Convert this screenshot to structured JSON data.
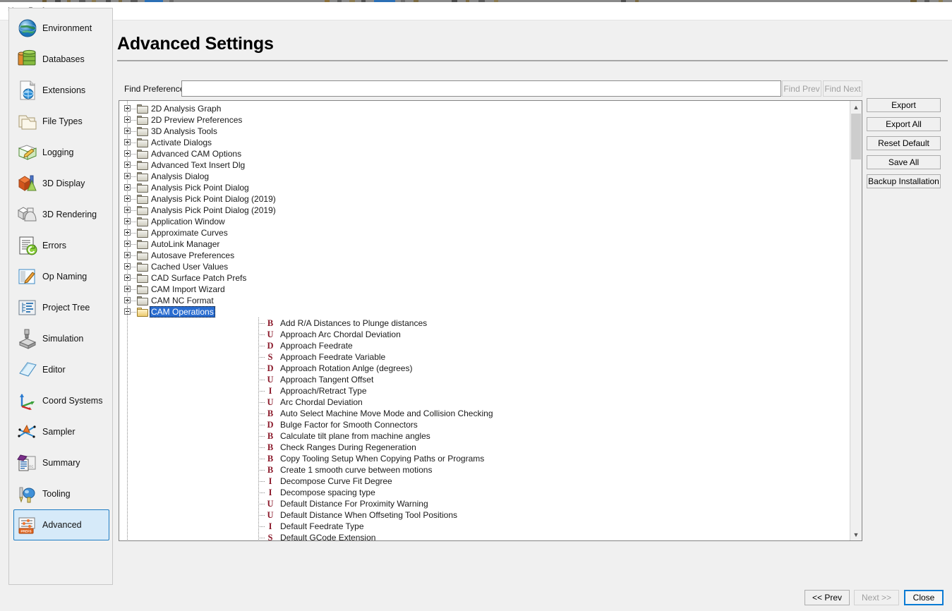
{
  "window": {
    "title": "User Preferences"
  },
  "page": {
    "title": "Advanced Settings"
  },
  "search": {
    "label": "Find Preference",
    "value": "",
    "placeholder": "",
    "find_prev": "Find Prev",
    "find_next": "Find Next"
  },
  "sidebar": {
    "items": [
      {
        "label": "Environment",
        "icon": "globe-icon",
        "selected": false
      },
      {
        "label": "Databases",
        "icon": "database-icon",
        "selected": false
      },
      {
        "label": "Extensions",
        "icon": "file-globe-icon",
        "selected": false
      },
      {
        "label": "File Types",
        "icon": "folders-icon",
        "selected": false
      },
      {
        "label": "Logging",
        "icon": "notebook-pen-icon",
        "selected": false
      },
      {
        "label": "3D Display",
        "icon": "cube-cone-icon",
        "selected": false
      },
      {
        "label": "3D Rendering",
        "icon": "shapes-gray-icon",
        "selected": false
      },
      {
        "label": "Errors",
        "icon": "error-refresh-icon",
        "selected": false
      },
      {
        "label": "Op Naming",
        "icon": "pencil-doc-icon",
        "selected": false
      },
      {
        "label": "Project Tree",
        "icon": "tree-list-icon",
        "selected": false
      },
      {
        "label": "Simulation",
        "icon": "machine-icon",
        "selected": false
      },
      {
        "label": "Editor",
        "icon": "editor-page-icon",
        "selected": false
      },
      {
        "label": "Coord Systems",
        "icon": "axes-icon",
        "selected": false
      },
      {
        "label": "Sampler",
        "icon": "sampler-icon",
        "selected": false
      },
      {
        "label": "Summary",
        "icon": "summary-nc-icon",
        "selected": false
      },
      {
        "label": "Tooling",
        "icon": "tool-icon",
        "selected": false
      },
      {
        "label": "Advanced",
        "icon": "prefs-slider-icon",
        "selected": true
      }
    ]
  },
  "tree": {
    "folders": [
      "2D Analysis Graph",
      "2D Preview Preferences",
      "3D Analysis Tools",
      "Activate Dialogs",
      "Advanced CAM Options",
      "Advanced Text Insert Dlg",
      "Analysis Dialog",
      "Analysis Pick Point Dialog",
      "Analysis Pick Point Dialog (2019)",
      "Analysis Pick Point Dialog (2019)",
      "Application Window",
      "Approximate Curves",
      "AutoLink Manager",
      "Autosave Preferences",
      "Cached User Values",
      "CAD Surface Patch Prefs",
      "CAM Import Wizard",
      "CAM NC Format"
    ],
    "selected_folder": "CAM Operations",
    "leaves": [
      {
        "type": "B",
        "label": "Add R/A Distances to Plunge distances"
      },
      {
        "type": "U",
        "label": "Approach Arc Chordal Deviation"
      },
      {
        "type": "D",
        "label": "Approach Feedrate"
      },
      {
        "type": "S",
        "label": "Approach Feedrate Variable"
      },
      {
        "type": "D",
        "label": "Approach Rotation Anlge (degrees)"
      },
      {
        "type": "U",
        "label": "Approach Tangent Offset"
      },
      {
        "type": "I",
        "label": "Approach/Retract Type"
      },
      {
        "type": "U",
        "label": "Arc Chordal Deviation"
      },
      {
        "type": "B",
        "label": "Auto Select Machine Move Mode and Collision Checking"
      },
      {
        "type": "D",
        "label": "Bulge Factor for Smooth Connectors"
      },
      {
        "type": "B",
        "label": "Calculate tilt plane from machine angles"
      },
      {
        "type": "B",
        "label": "Check Ranges During Regeneration"
      },
      {
        "type": "B",
        "label": "Copy Tooling Setup When Copying Paths or Programs"
      },
      {
        "type": "B",
        "label": "Create  1 smooth curve between motions"
      },
      {
        "type": "I",
        "label": "Decompose Curve Fit Degree"
      },
      {
        "type": "I",
        "label": "Decompose spacing type"
      },
      {
        "type": "U",
        "label": "Default Distance For Proximity Warning"
      },
      {
        "type": "U",
        "label": "Default Distance When Offseting Tool Positions"
      },
      {
        "type": "I",
        "label": "Default Feedrate Type"
      },
      {
        "type": "S",
        "label": "Default GCode Extension"
      }
    ]
  },
  "actions": {
    "right": [
      "Export",
      "Export All",
      "Reset Default",
      "Save All",
      "Backup Installation"
    ],
    "bottom": {
      "prev": "<< Prev",
      "next": "Next >>",
      "close": "Close"
    }
  },
  "colors": {
    "accent": "#0a7bd4",
    "selection": "#2a6dd0",
    "type_letter": "#8b1a2b",
    "panel": "#f0f0f0",
    "nav_selected": "#d6eaf9"
  }
}
